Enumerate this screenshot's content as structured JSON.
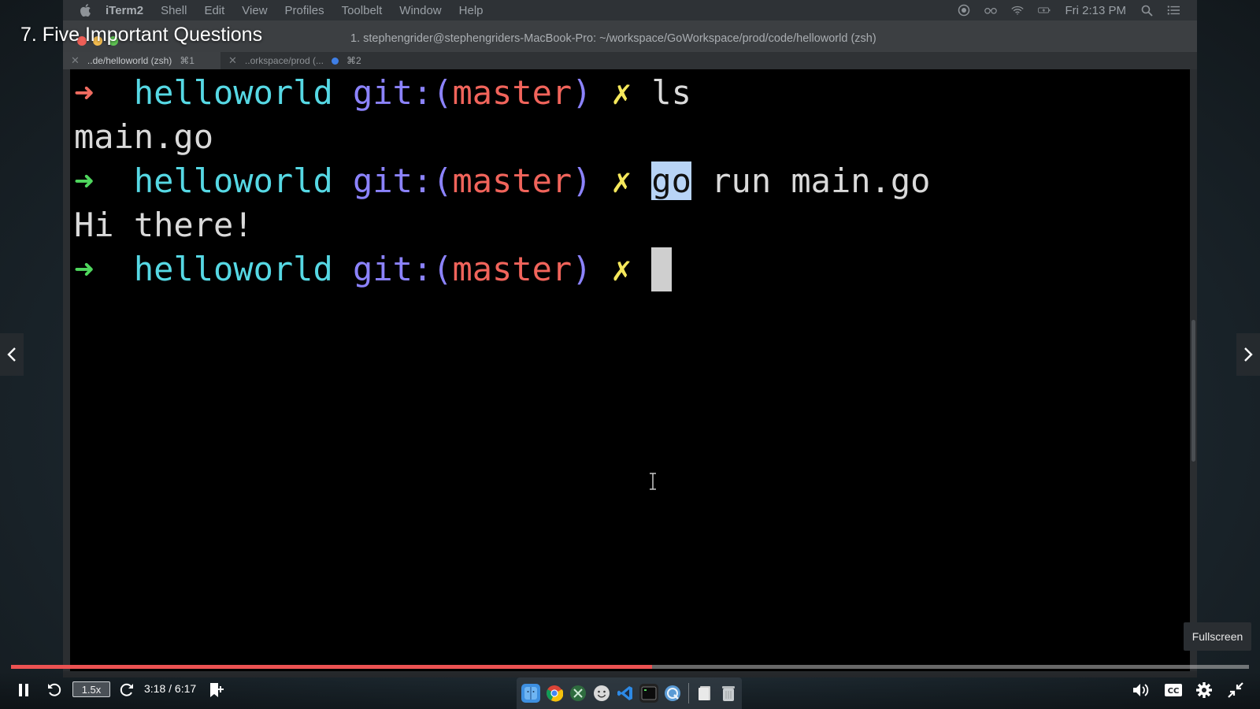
{
  "lecture": {
    "title": "7. Five Important Questions"
  },
  "menubar": {
    "app": "iTerm2",
    "items": [
      "Shell",
      "Edit",
      "View",
      "Profiles",
      "Toolbelt",
      "Window",
      "Help"
    ],
    "clock": "Fri 2:13 PM"
  },
  "window": {
    "title": "1. stephengrider@stephengriders-MacBook-Pro: ~/workspace/GoWorkspace/prod/code/helloworld (zsh)",
    "tabs": [
      {
        "label": "..de/helloworld (zsh)",
        "shortcut": "⌘1"
      },
      {
        "label": "..orkspace/prod (...",
        "shortcut": "⌘2"
      }
    ]
  },
  "terminal": {
    "arrow": "➜",
    "dir": "helloworld",
    "git_prefix": "git:(",
    "branch": "master",
    "git_suffix": ")",
    "dirty": "✗",
    "cmd1": "ls",
    "out1": "main.go",
    "cmd2_highlight": "go",
    "cmd2_rest": " run main.go",
    "out2": "Hi there!"
  },
  "player": {
    "rate": "1.5x",
    "time": "3:18 / 6:17",
    "progress": 0.518,
    "tooltip": "Fullscreen"
  },
  "colors": {
    "progress": "#ec5252",
    "prompt_cyan": "#56d8e4",
    "prompt_blue": "#8c83ff",
    "prompt_red": "#f1645b",
    "prompt_yellow": "#f5e85b"
  }
}
